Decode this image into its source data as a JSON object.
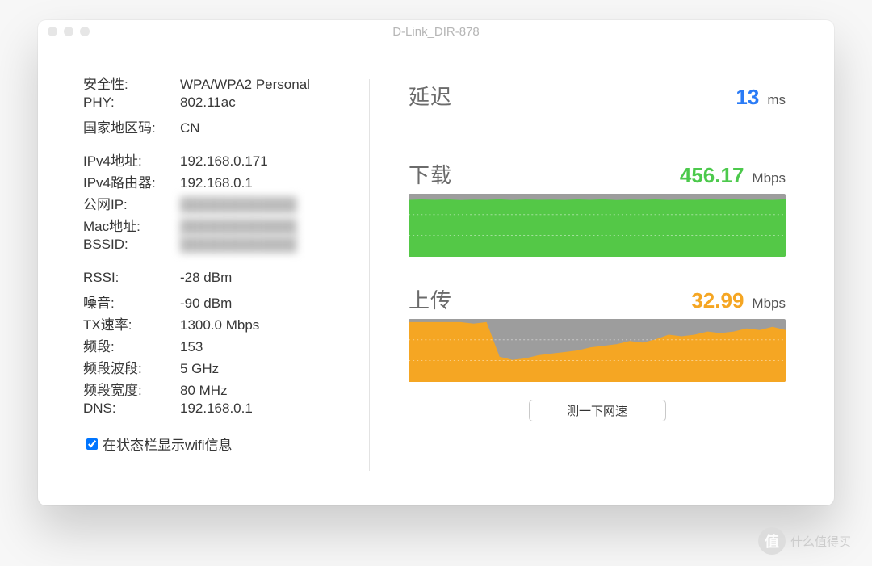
{
  "window_title": "D-Link_DIR-878",
  "info_groups": [
    [
      {
        "k": "安全性:",
        "v": "WPA/WPA2 Personal"
      },
      {
        "k": "PHY:",
        "v": "802.11ac"
      },
      {
        "k": "国家地区码:",
        "v": "CN"
      }
    ],
    [
      {
        "k": "IPv4地址:",
        "v": "192.168.0.171"
      },
      {
        "k": "IPv4路由器:",
        "v": "192.168.0.1"
      },
      {
        "k": "公网IP:",
        "v": "",
        "blur": true
      },
      {
        "k": "Mac地址:",
        "v": "",
        "blur": true
      },
      {
        "k": "BSSID:",
        "v": "",
        "blur": true
      }
    ],
    [
      {
        "k": "RSSI:",
        "v": "-28 dBm"
      },
      {
        "k": "噪音:",
        "v": "-90 dBm"
      },
      {
        "k": "TX速率:",
        "v": "1300.0 Mbps"
      },
      {
        "k": "频段:",
        "v": "153"
      },
      {
        "k": "频段波段:",
        "v": "5 GHz"
      },
      {
        "k": "频段宽度:",
        "v": "80 MHz"
      },
      {
        "k": "DNS:",
        "v": "192.168.0.1"
      }
    ]
  ],
  "checkbox_label": "在状态栏显示wifi信息",
  "latency": {
    "title": "延迟",
    "value": "13",
    "unit": "ms"
  },
  "download": {
    "title": "下载",
    "value": "456.17",
    "unit": "Mbps"
  },
  "upload": {
    "title": "上传",
    "value": "32.99",
    "unit": "Mbps"
  },
  "speedtest_btn": "测一下网速",
  "colors": {
    "download_fill": "#54c847",
    "download_bg": "#9d9d9d",
    "upload_fill": "#f5a623",
    "upload_bg": "#9d9d9d"
  },
  "chart_data": [
    {
      "type": "area",
      "title": "下载",
      "ylabel": "Mbps",
      "ylim": [
        0,
        500
      ],
      "values": [
        451,
        455,
        452,
        455,
        450,
        454,
        452,
        456,
        450,
        455,
        452,
        454,
        451,
        455,
        452,
        456,
        450,
        454,
        452,
        455,
        451,
        454,
        452,
        456,
        453,
        455,
        452,
        454,
        451,
        456
      ]
    },
    {
      "type": "area",
      "title": "上传",
      "ylabel": "Mbps",
      "ylim": [
        0,
        40
      ],
      "values": [
        38,
        38,
        38,
        38,
        38,
        37,
        38,
        16,
        14,
        15,
        17,
        18,
        19,
        20,
        22,
        23,
        24,
        26,
        25,
        27,
        30,
        29,
        30,
        32,
        31,
        32,
        34,
        33,
        35,
        33
      ]
    }
  ],
  "watermark": "什么值得买"
}
